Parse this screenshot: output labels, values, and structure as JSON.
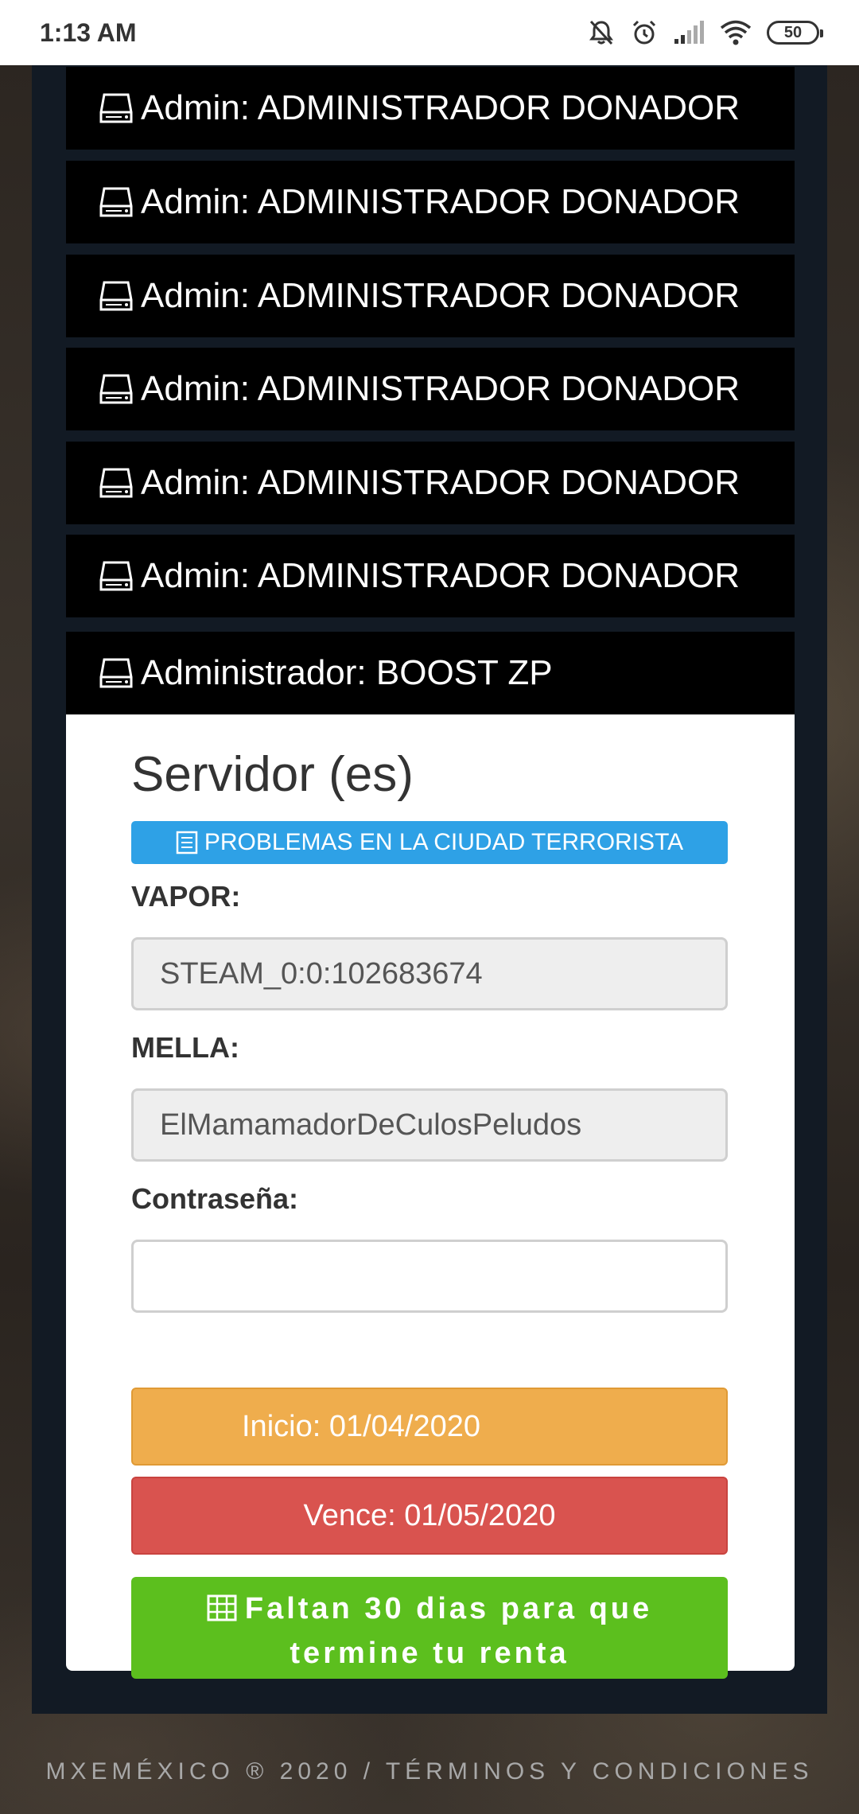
{
  "status_bar": {
    "time": "1:13 AM",
    "battery": "50"
  },
  "admin_items": [
    {
      "label": "Admin: ADMINISTRADOR DONADOR"
    },
    {
      "label": "Admin: ADMINISTRADOR DONADOR"
    },
    {
      "label": "Admin: ADMINISTRADOR DONADOR"
    },
    {
      "label": "Admin: ADMINISTRADOR DONADOR"
    },
    {
      "label": "Admin: ADMINISTRADOR DONADOR"
    },
    {
      "label": "Admin: ADMINISTRADOR DONADOR"
    },
    {
      "label": "Administrador: BOOST ZP"
    }
  ],
  "detail": {
    "title": "Servidor (es)",
    "server_name": "PROBLEMAS EN LA CIUDAD TERRORISTA",
    "steam_label": "VAPOR:",
    "steam_value": "STEAM_0:0:102683674",
    "nick_label": "MELLA:",
    "nick_value": "ElMamamadorDeCulosPeludos",
    "password_label": "Contraseña:",
    "password_value": "",
    "start_date": "Inicio: 01/04/2020",
    "end_date": "Vence: 01/05/2020",
    "remaining_line1": "Faltan 30 dias para que",
    "remaining_line2": "termine tu renta"
  },
  "colors": {
    "server_badge": "#2ea1e6",
    "start_date": "#efad4d",
    "end_date": "#d9534f",
    "remaining": "#5cbf1e"
  },
  "footer": {
    "text": "MXEMÉXICO ® 2020 / TÉRMINOS Y CONDICIONES"
  }
}
